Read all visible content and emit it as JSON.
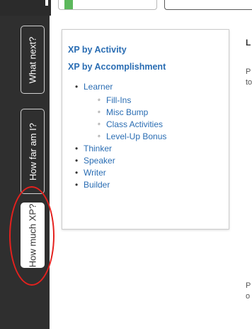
{
  "sidebar": {
    "tabs": [
      {
        "label": "What next?"
      },
      {
        "label": "How far am I?"
      },
      {
        "label": "How much XP?"
      }
    ]
  },
  "panel": {
    "heading_activity": "XP by Activity",
    "heading_accomplishment": "XP by Accomplishment",
    "items": [
      {
        "label": "Learner",
        "subitems": [
          "Fill-Ins",
          "Misc Bump",
          "Class Activities",
          "Level-Up Bonus"
        ]
      },
      {
        "label": "Thinker"
      },
      {
        "label": "Speaker"
      },
      {
        "label": "Writer"
      },
      {
        "label": "Builder"
      }
    ]
  },
  "right_text": {
    "l": "L",
    "p1": "P",
    "to": "to",
    "p2": "P",
    "o": "o"
  },
  "colors": {
    "link": "#2a6db3",
    "sidebar": "#2f2f2f",
    "highlight": "#e5211e",
    "tab_accent": "#5cb85c"
  }
}
